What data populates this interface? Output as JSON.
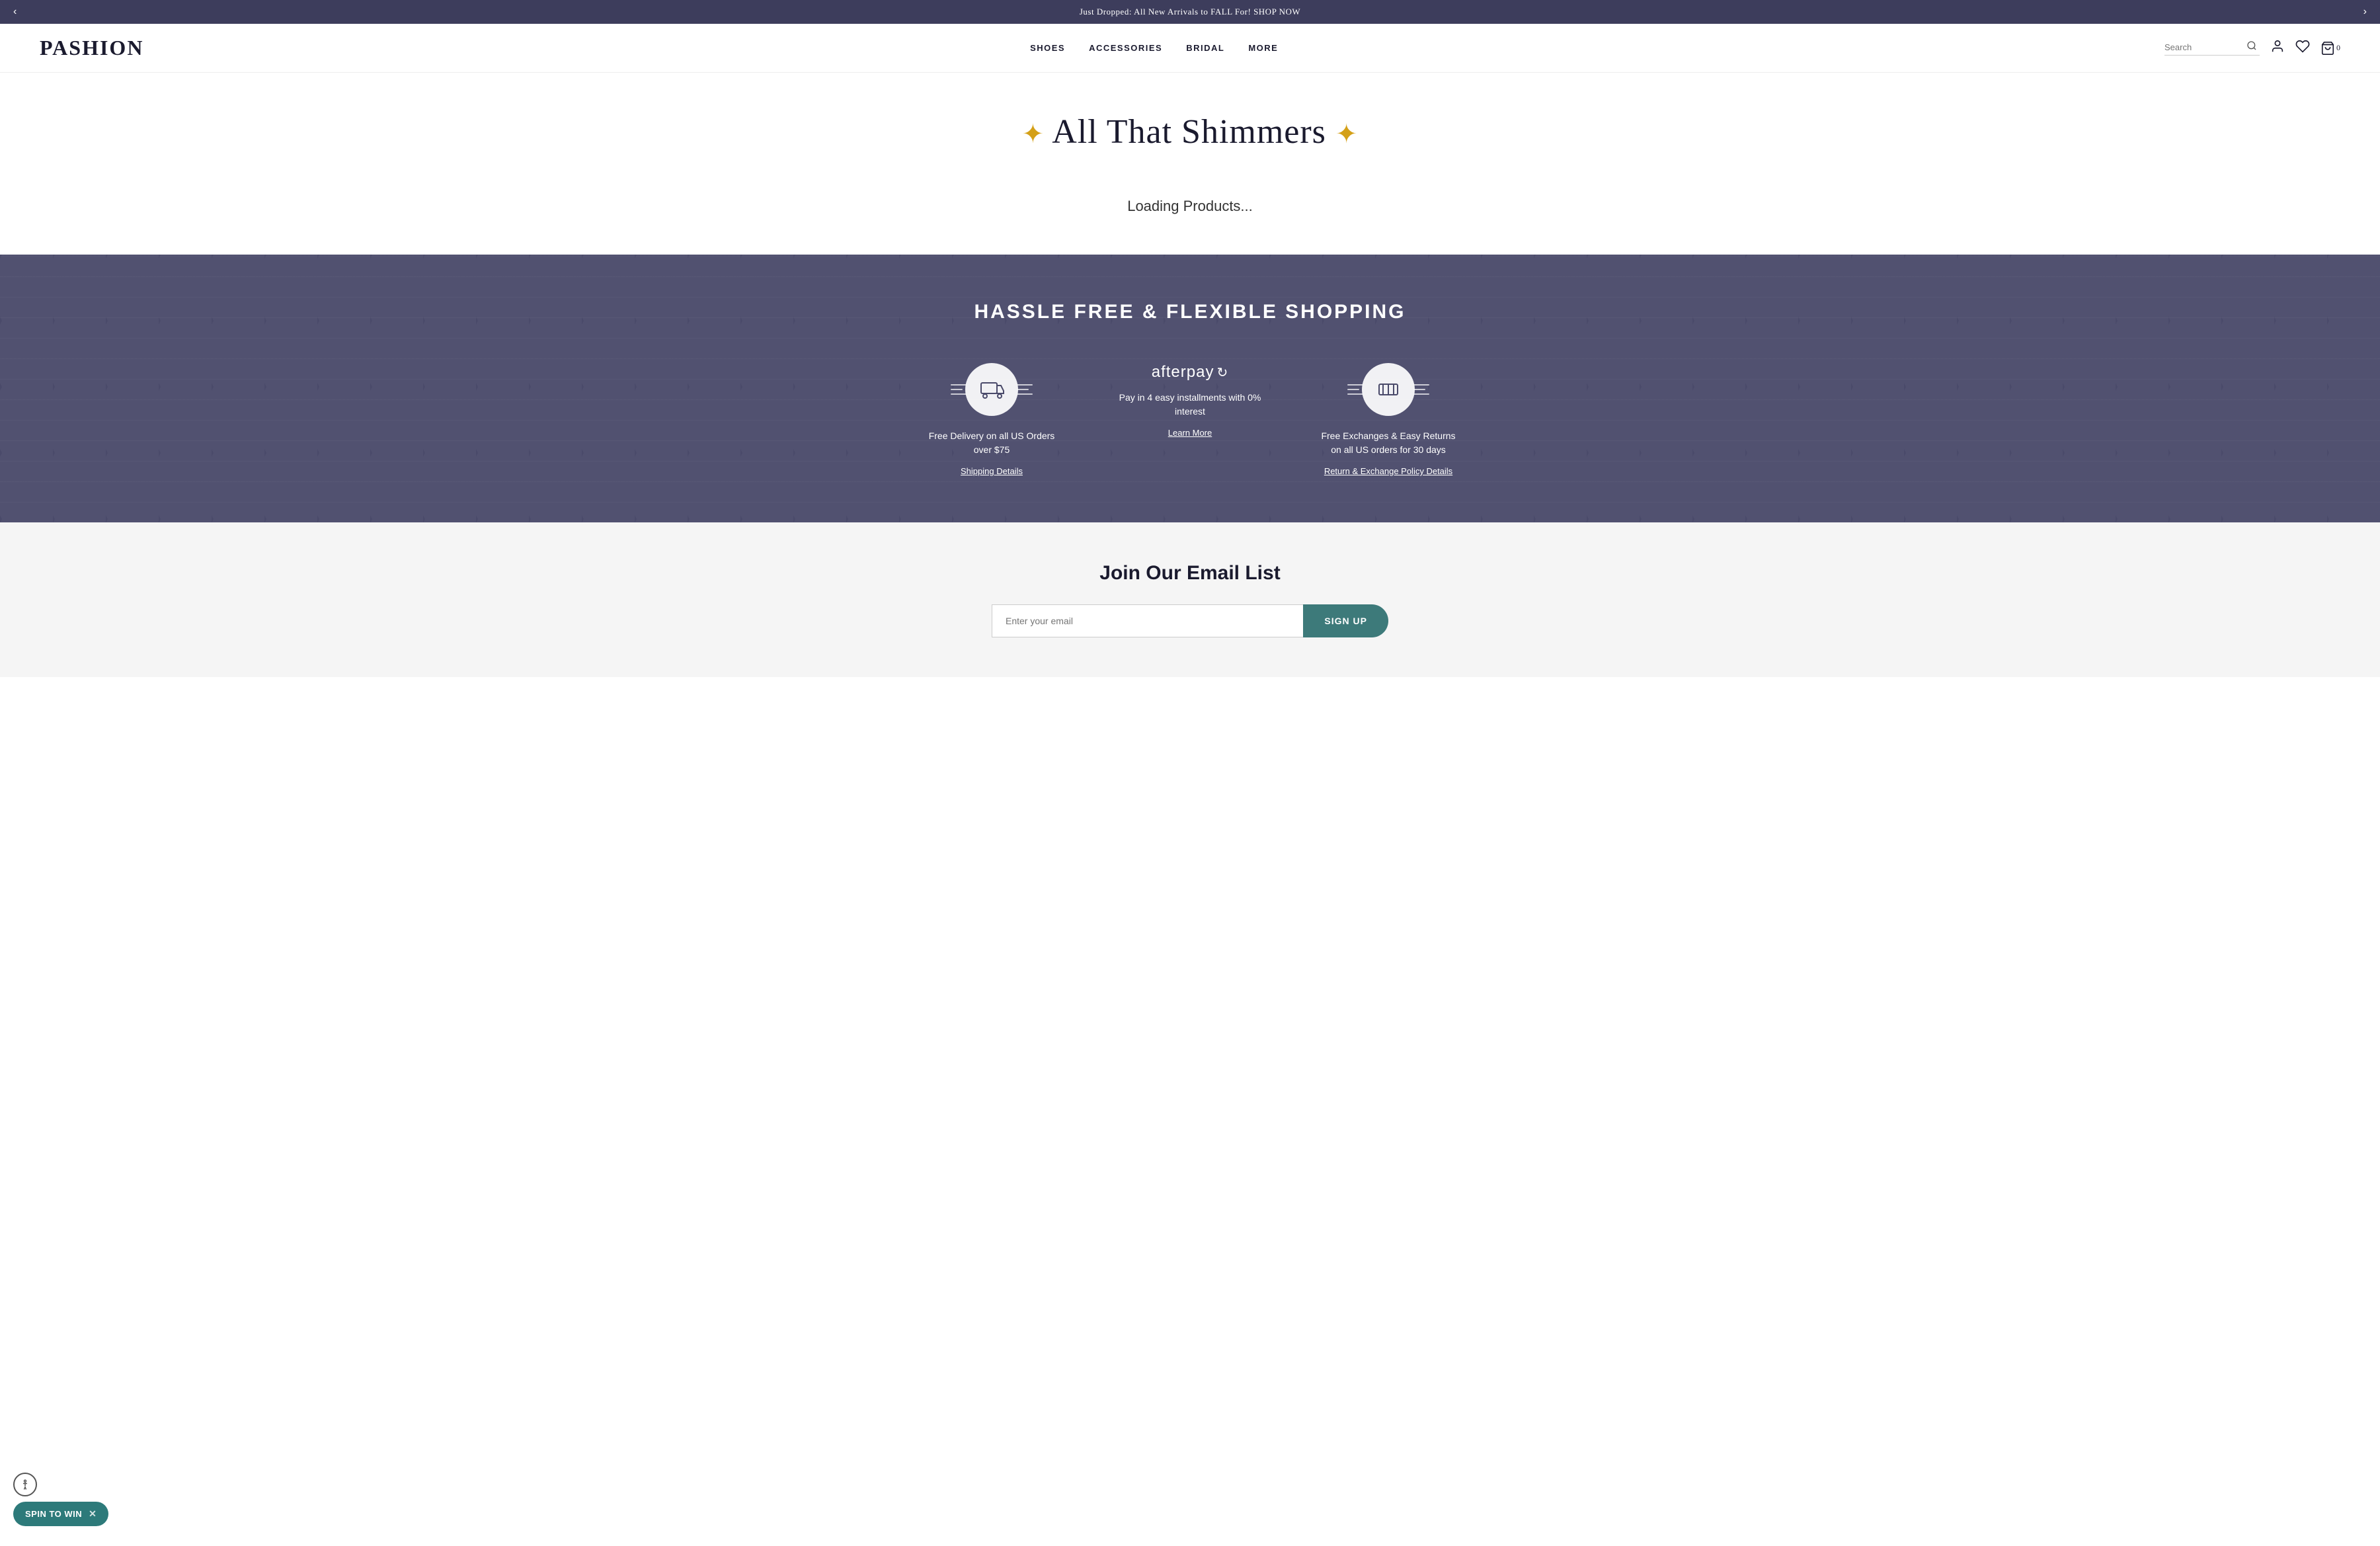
{
  "announcement": {
    "text": "Just Dropped: All New Arrivals to FALL For! SHOP NOW",
    "prev_label": "‹",
    "next_label": "›"
  },
  "header": {
    "logo": "PASHION",
    "nav_items": [
      {
        "label": "SHOES",
        "href": "#"
      },
      {
        "label": "ACCESSORIES",
        "href": "#"
      },
      {
        "label": "BRIDAL",
        "href": "#"
      },
      {
        "label": "MORE",
        "href": "#"
      }
    ],
    "search_placeholder": "Search",
    "cart_count": "0"
  },
  "hero": {
    "sparkle_left": "✦",
    "title": "All That Shimmers",
    "sparkle_right": "✦",
    "loading_text": "Loading Products..."
  },
  "features": {
    "section_title": "HASSLE FREE & FLEXIBLE SHOPPING",
    "items": [
      {
        "id": "delivery",
        "text": "Free Delivery on all US Orders over $75",
        "link_label": "Shipping Details"
      },
      {
        "id": "afterpay",
        "logo": "afterpay",
        "text": "Pay in 4 easy installments with 0% interest",
        "link_label": "Learn More"
      },
      {
        "id": "returns",
        "text": "Free Exchanges & Easy Returns on all US orders for 30 days",
        "link_label": "Return & Exchange Policy Details"
      }
    ]
  },
  "email_section": {
    "title": "Join Our Email List",
    "input_placeholder": "Enter your email",
    "button_label": "SIGN UP"
  },
  "spin_widget": {
    "label": "SPIN TO WIN",
    "close_label": "✕"
  }
}
